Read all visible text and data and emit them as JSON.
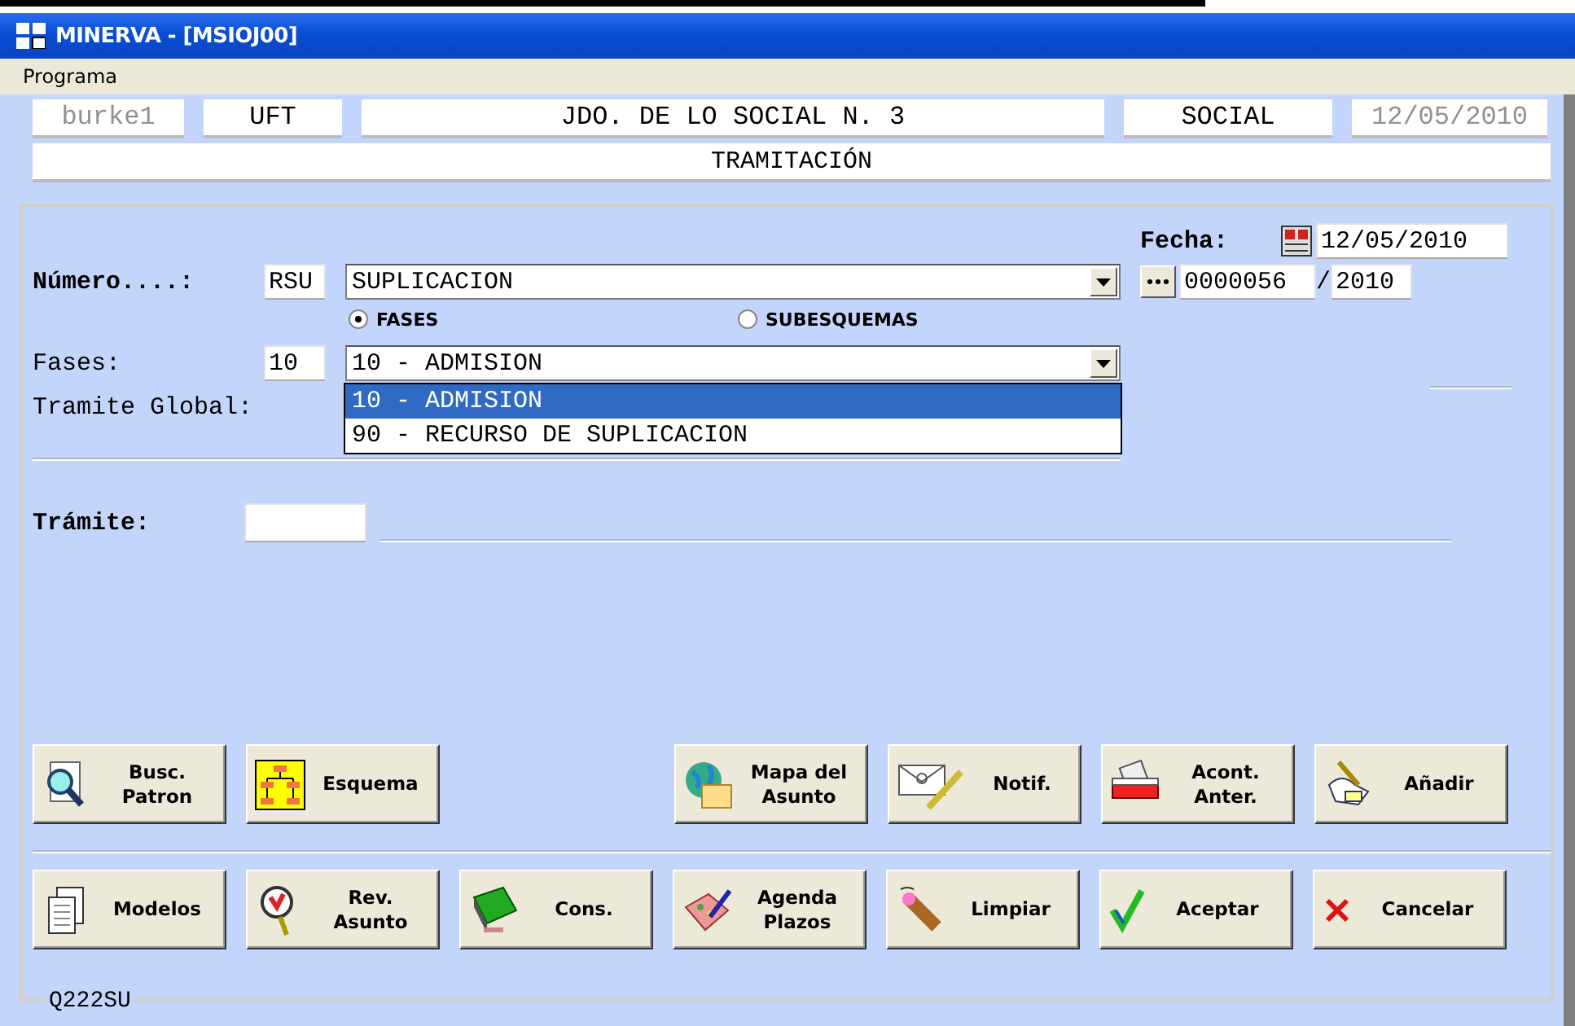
{
  "window": {
    "title": "MINERVA - [MSIOJ00]"
  },
  "menu": [
    "Programa"
  ],
  "header": {
    "cells": [
      {
        "text": "burke1",
        "disabled": true
      },
      {
        "text": "UFT",
        "disabled": false
      },
      {
        "text": "JDO. DE LO SOCIAL N. 3",
        "disabled": false
      },
      {
        "text": "SOCIAL",
        "disabled": false
      },
      {
        "text": "12/05/2010",
        "disabled": true
      }
    ],
    "section": "TRAMITACIÓN"
  },
  "form": {
    "fecha_label": "Fecha:",
    "fecha_value": "12/05/2010",
    "numero_label": "Número....:",
    "numero_code": "RSU",
    "numero_combo": "SUPLICACION",
    "numero_value": "0000056",
    "numero_separator": "/",
    "numero_year": "2010",
    "radios": [
      {
        "label": "FASES",
        "selected": true
      },
      {
        "label": "SUBESQUEMAS",
        "selected": false
      }
    ],
    "fases_label": "Fases:",
    "fases_code": "10",
    "fases_combo": "10 - ADMISION",
    "fases_options": [
      {
        "label": "10 - ADMISION",
        "selected": true
      },
      {
        "label": "90 - RECURSO DE SUPLICACION",
        "selected": false
      }
    ],
    "tramite_global_label": "Tramite Global:",
    "tramite_label": "Trámite:"
  },
  "buttons_row_1": [
    {
      "kind": "search",
      "lines": [
        "Busc.",
        "Patron"
      ]
    },
    {
      "kind": "chart",
      "lines": [
        "Esquema"
      ]
    },
    {
      "kind": "globe",
      "lines": [
        "Mapa del",
        "Asunto"
      ]
    },
    {
      "kind": "mail",
      "lines": [
        "Notif."
      ]
    },
    {
      "kind": "cardbox",
      "lines": [
        "Acont.",
        "Anter."
      ]
    },
    {
      "kind": "hand",
      "lines": [
        "Añadir"
      ]
    }
  ],
  "buttons_row_2": [
    {
      "kind": "docs",
      "lines": [
        "Modelos"
      ]
    },
    {
      "kind": "lens",
      "lines": [
        "Rev.",
        "Asunto"
      ]
    },
    {
      "kind": "book",
      "lines": [
        "Cons."
      ]
    },
    {
      "kind": "palette",
      "lines": [
        "Agenda",
        "Plazos"
      ]
    },
    {
      "kind": "eraser",
      "lines": [
        "Limpiar"
      ]
    },
    {
      "kind": "check",
      "lines": [
        "Aceptar"
      ]
    },
    {
      "kind": "cross",
      "lines": [
        "Cancelar"
      ]
    }
  ],
  "footer_code": "Q222SU"
}
